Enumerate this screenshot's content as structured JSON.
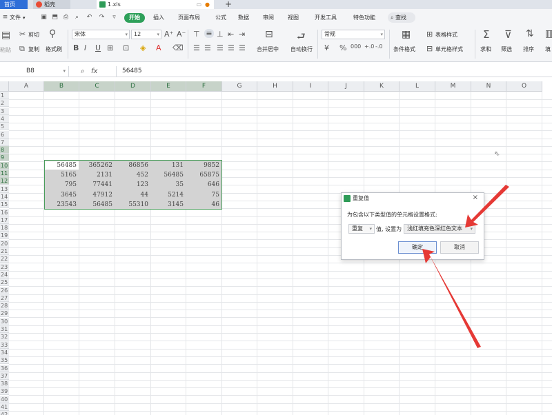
{
  "tabs": {
    "home": "首页",
    "docer": "稻壳",
    "file": "1.xls"
  },
  "menu": {
    "file": "文件",
    "start": "开始",
    "insert": "插入",
    "page_layout": "页面布局",
    "formula": "公式",
    "data": "数据",
    "review": "审阅",
    "view": "视图",
    "developer": "开发工具",
    "special": "特色功能",
    "search": "查找"
  },
  "ribbon": {
    "paste": "粘贴",
    "cut": "剪切",
    "copy": "复制",
    "format_painter": "格式刷",
    "font_name": "宋体",
    "font_size": "12",
    "merge_center": "合并居中",
    "wrap_text": "自动换行",
    "number_format": "常规",
    "conditional_format": "条件格式",
    "table_style": "表格样式",
    "cell_style": "单元格样式",
    "sum": "求和",
    "filter": "筛选",
    "sort": "排序",
    "fill": "填"
  },
  "formula_bar": {
    "cell_ref": "B8",
    "fx": "fx",
    "content": "56485"
  },
  "columns": [
    "A",
    "B",
    "C",
    "D",
    "E",
    "F",
    "G",
    "H",
    "I",
    "J",
    "K",
    "L",
    "M",
    "N",
    "O"
  ],
  "rows": [
    "1",
    "2",
    "3",
    "4",
    "5",
    "6",
    "7",
    "8",
    "9",
    "10",
    "11",
    "12",
    "13",
    "14",
    "15",
    "16",
    "17",
    "18",
    "19",
    "20",
    "21",
    "22",
    "23",
    "24",
    "25",
    "26",
    "27",
    "28",
    "29",
    "30",
    "31",
    "32",
    "33",
    "34",
    "35",
    "36",
    "37",
    "38",
    "39",
    "40",
    "41",
    "42"
  ],
  "table": [
    [
      "56485",
      "365262",
      "86856",
      "131",
      "9852"
    ],
    [
      "5165",
      "2131",
      "452",
      "56485",
      "65875"
    ],
    [
      "795",
      "77441",
      "123",
      "35",
      "646"
    ],
    [
      "3645",
      "47912",
      "44",
      "5214",
      "75"
    ],
    [
      "23543",
      "56485",
      "55310",
      "3145",
      "46"
    ]
  ],
  "dialog": {
    "title": "重复值",
    "prompt": "为包含以下类型值的单元格设置格式:",
    "rule_type": "重复",
    "value_set_to": "值, 设置为",
    "format": "浅红填充色深红色文本",
    "ok": "确定",
    "cancel": "取消",
    "close": "×"
  },
  "colors": {
    "accent": "#2ea05a",
    "arrow": "#e53935",
    "selection": "#d3d3d3"
  }
}
